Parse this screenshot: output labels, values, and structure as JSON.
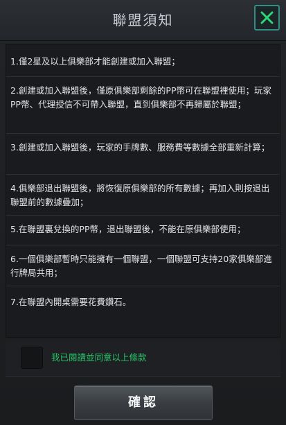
{
  "dialog": {
    "title": "聯盟須知",
    "close_icon": "close-icon"
  },
  "rules": [
    "1.僅2星及以上俱樂部才能創建或加入聯盟；",
    "2.創建或加入聯盟後，僅原俱樂部剩餘的PP幣可在聯盟裡使用；玩家PP幣、代理授信不可帶入聯盟，直到俱樂部不再歸屬於聯盟；",
    "3.創建或加入聯盟後，玩家的手牌數、服務費等數據全部重新計算；",
    "4.俱樂部退出聯盟後，將恢復原俱樂部的所有數據；再加入則按退出聯盟前的數據疊加；",
    "5.在聯盟裏兌換的PP幣，退出聯盟後，不能在原俱樂部使用；",
    "6.一個俱樂部暫時只能擁有一個聯盟，一個聯盟可支持20家俱樂部進行牌局共用；",
    "7.在聯盟內開桌需要花費鑽石。"
  ],
  "agreement": {
    "checked": false,
    "label": "我已閱讀並同意以上條款"
  },
  "confirm_label": "確認",
  "colors": {
    "accent_green": "#29c66a",
    "close_border": "#2f8f84",
    "close_x": "#2ed47a",
    "background": "#1d1f22"
  }
}
